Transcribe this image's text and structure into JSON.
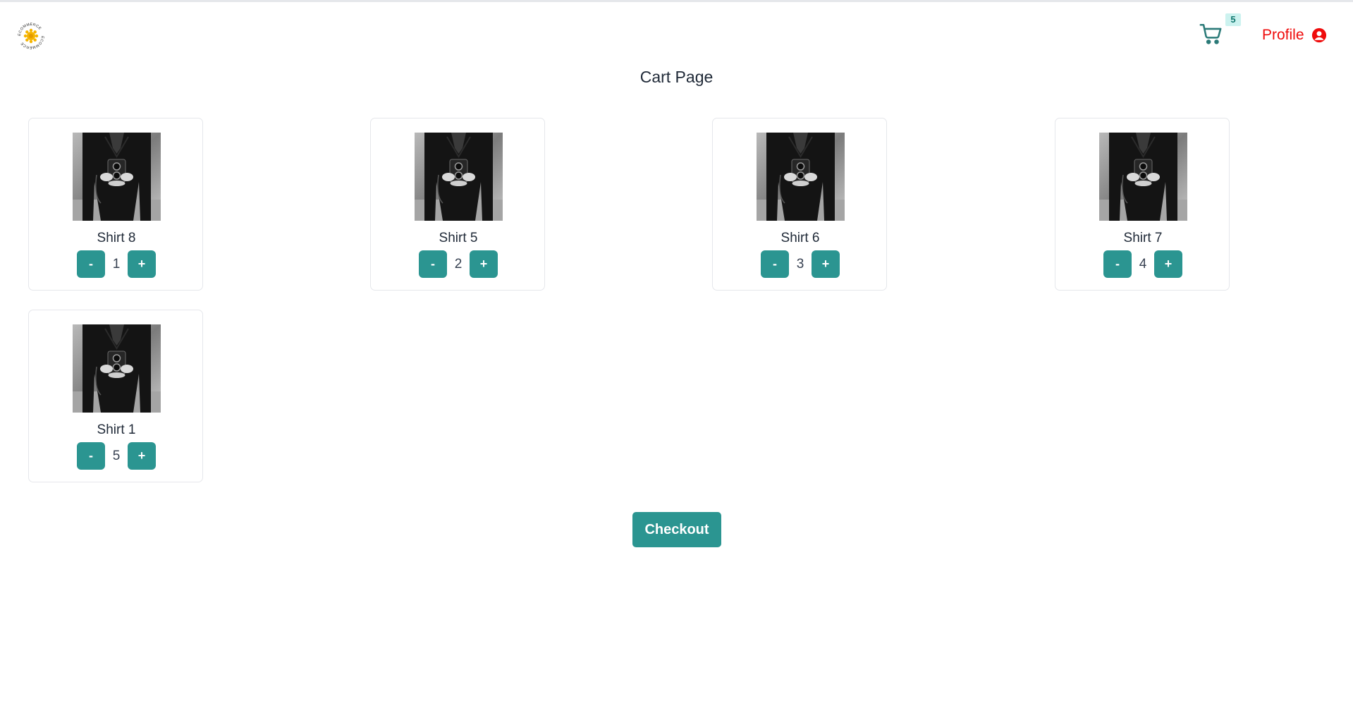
{
  "header": {
    "logo_text": "ECOMMERCE",
    "cart_icon": "shopping-cart-icon",
    "cart_count": "5",
    "profile_label": "Profile",
    "profile_icon": "user-circle-icon",
    "accent_color": "#2b9591",
    "profile_color": "#ef0b0b"
  },
  "page": {
    "title": "Cart Page"
  },
  "cart": {
    "items": [
      {
        "name": "Shirt 8",
        "quantity": "1",
        "decrement_label": "-",
        "increment_label": "+",
        "image": "man-holding-camera-photo"
      },
      {
        "name": "Shirt 5",
        "quantity": "2",
        "decrement_label": "-",
        "increment_label": "+",
        "image": "man-holding-camera-photo"
      },
      {
        "name": "Shirt 6",
        "quantity": "3",
        "decrement_label": "-",
        "increment_label": "+",
        "image": "man-holding-camera-photo"
      },
      {
        "name": "Shirt 7",
        "quantity": "4",
        "decrement_label": "-",
        "increment_label": "+",
        "image": "man-holding-camera-photo"
      },
      {
        "name": "Shirt 1",
        "quantity": "5",
        "decrement_label": "-",
        "increment_label": "+",
        "image": "man-holding-camera-photo"
      }
    ],
    "checkout_label": "Checkout"
  }
}
